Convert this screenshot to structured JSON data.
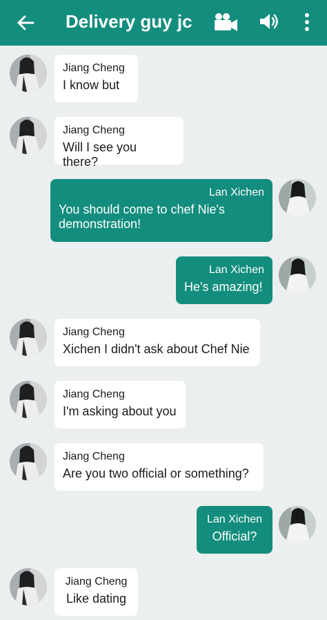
{
  "header": {
    "title": "Delivery guy jc",
    "back_icon": "arrow-left-icon",
    "video_icon": "video-camera-icon",
    "speaker_icon": "speaker-icon",
    "menu_icon": "more-vert-icon"
  },
  "colors": {
    "header_bg": "#138d7d",
    "outgoing_bubble": "#138d7d",
    "incoming_bubble": "#ffffff",
    "chat_bg": "#ecefef"
  },
  "messages": [
    {
      "sender": "Jiang Cheng",
      "text": "I know but",
      "direction": "in"
    },
    {
      "sender": "Jiang Cheng",
      "text": "Will I see you there?",
      "direction": "in"
    },
    {
      "sender": "Lan Xichen",
      "text": "You should come to chef Nie's demonstration!",
      "direction": "out"
    },
    {
      "sender": "Lan Xichen",
      "text": "He's amazing!",
      "direction": "out"
    },
    {
      "sender": "Jiang Cheng",
      "text": "Xichen I didn't ask about Chef Nie",
      "direction": "in"
    },
    {
      "sender": "Jiang Cheng",
      "text": "I'm asking about you",
      "direction": "in"
    },
    {
      "sender": "Jiang Cheng",
      "text": "Are you two official or something?",
      "direction": "in"
    },
    {
      "sender": "Lan Xichen",
      "text": "Official?",
      "direction": "out"
    },
    {
      "sender": "Jiang Cheng",
      "text": "Like dating",
      "direction": "in"
    }
  ]
}
